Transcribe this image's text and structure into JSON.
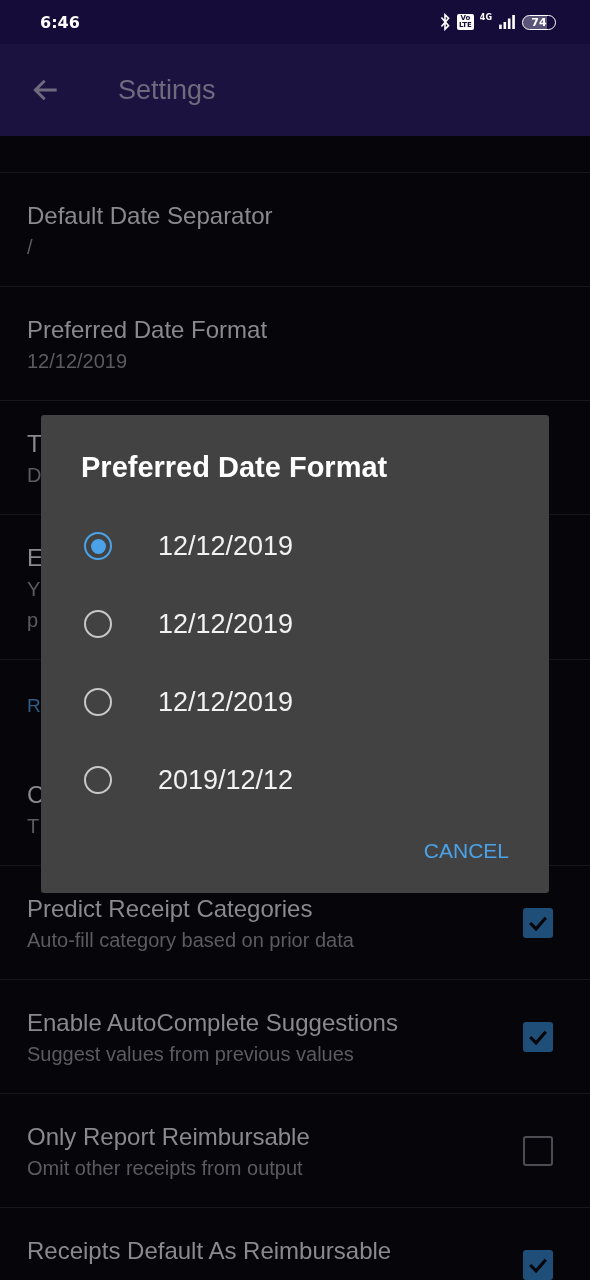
{
  "status_bar": {
    "time": "6:46",
    "volte": [
      "Vo",
      "LTE"
    ],
    "network": "4G",
    "battery": "74"
  },
  "app_bar": {
    "title": "Settings"
  },
  "settings": [
    {
      "kind": "item",
      "title": "Default Date Separator",
      "subtitle": "/"
    },
    {
      "kind": "item",
      "title": "Preferred Date Format",
      "subtitle": "12/12/2019"
    },
    {
      "kind": "item",
      "title": "T",
      "subtitle": "D"
    },
    {
      "kind": "item",
      "title": "E",
      "subtitle": "Y",
      "subtitle_2": "p"
    },
    {
      "kind": "header",
      "title": "R"
    },
    {
      "kind": "item",
      "title": "C",
      "subtitle": "T"
    },
    {
      "kind": "checkbox",
      "title": "Predict Receipt Categories",
      "subtitle": "Auto-fill category based on prior data",
      "checked": true
    },
    {
      "kind": "checkbox",
      "title": "Enable AutoComplete Suggestions",
      "subtitle": "Suggest values from previous values",
      "checked": true
    },
    {
      "kind": "checkbox",
      "title": "Only Report Reimbursable",
      "subtitle": "Omit other receipts from output",
      "checked": false
    },
    {
      "kind": "checkbox",
      "title": "Receipts Default As Reimbursable",
      "checked": true
    }
  ],
  "dialog": {
    "title": "Preferred Date Format",
    "options": [
      {
        "label": "12/12/2019",
        "selected": true
      },
      {
        "label": "12/12/2019",
        "selected": false
      },
      {
        "label": "12/12/2019",
        "selected": false
      },
      {
        "label": "2019/12/12",
        "selected": false
      }
    ],
    "cancel": "CANCEL"
  }
}
